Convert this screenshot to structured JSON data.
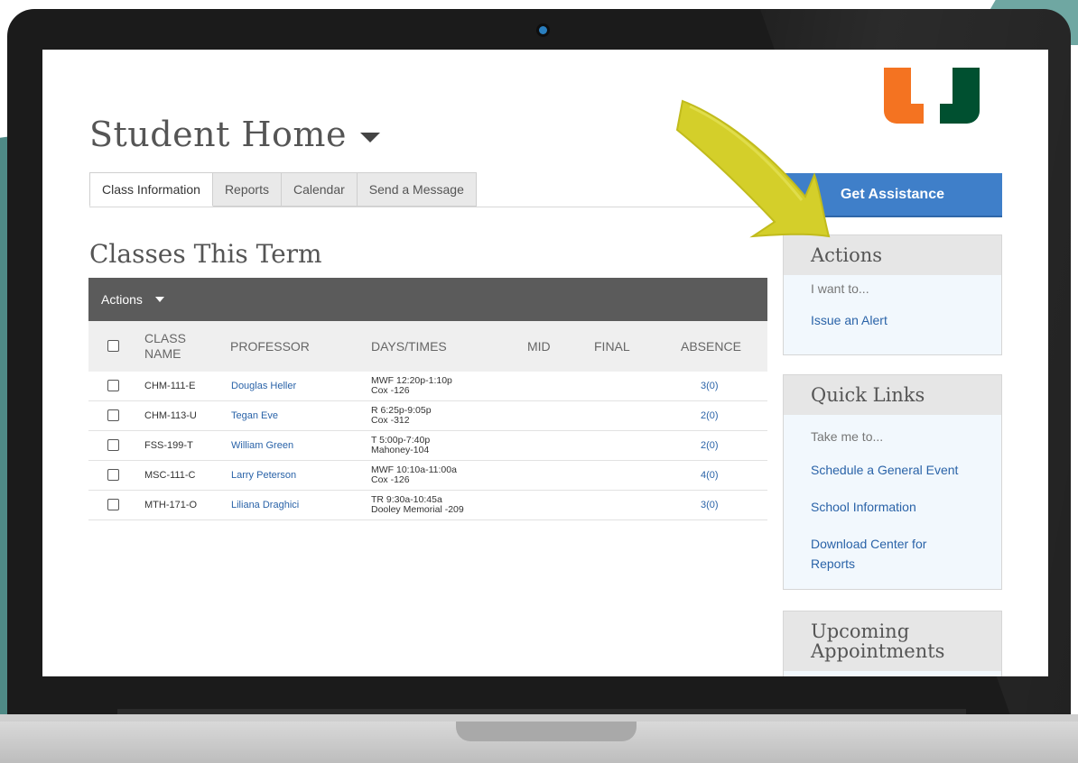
{
  "app": {
    "page_title": "Student Home",
    "tabs": [
      {
        "label": "Class Information",
        "active": true
      },
      {
        "label": "Reports",
        "active": false
      },
      {
        "label": "Calendar",
        "active": false
      },
      {
        "label": "Send a Message",
        "active": false
      }
    ]
  },
  "classes": {
    "section_title": "Classes This Term",
    "actions_label": "Actions",
    "columns": [
      "CLASS NAME",
      "PROFESSOR",
      "DAYS/TIMES",
      "MID",
      "FINAL",
      "ABSENCE"
    ],
    "rows": [
      {
        "class_name": "CHM-111-E",
        "professor": "Douglas Heller",
        "days": "MWF 12:20p-1:10p",
        "location": "Cox -126",
        "mid": "",
        "final": "",
        "absence": "3(0)"
      },
      {
        "class_name": "CHM-113-U",
        "professor": "Tegan Eve",
        "days": "R 6:25p-9:05p",
        "location": "Cox -312",
        "mid": "",
        "final": "",
        "absence": "2(0)"
      },
      {
        "class_name": "FSS-199-T",
        "professor": "William Green",
        "days": "T 5:00p-7:40p",
        "location": "Mahoney-104",
        "mid": "",
        "final": "",
        "absence": "2(0)"
      },
      {
        "class_name": "MSC-111-C",
        "professor": "Larry Peterson",
        "days": "MWF 10:10a-11:00a",
        "location": "Cox -126",
        "mid": "",
        "final": "",
        "absence": "4(0)"
      },
      {
        "class_name": "MTH-171-O",
        "professor": "Liliana Draghici",
        "days": "TR 9:30a-10:45a",
        "location": "Dooley Memorial -209",
        "mid": "",
        "final": "",
        "absence": "3(0)"
      }
    ]
  },
  "sidebar": {
    "assist_button": "Get Assistance",
    "actions_panel": {
      "title": "Actions",
      "subtitle": "I want to...",
      "links": [
        "Issue an Alert"
      ]
    },
    "quick_links_panel": {
      "title": "Quick Links",
      "subtitle": "Take me to...",
      "links": [
        "Schedule a General Event",
        "School Information",
        "Download Center for Reports"
      ]
    },
    "appointments_panel": {
      "title": "Upcoming Appointments"
    }
  },
  "colors": {
    "accent_blue": "#3f7fc9",
    "link_blue": "#2a63a8",
    "logo_orange": "#f47321",
    "logo_green": "#005030",
    "arrow_yellow": "#d4cf2a"
  },
  "icons": {
    "title_dropdown": "caret-down-icon",
    "actions_dropdown": "caret-down-icon",
    "row_select": "checkbox-icon",
    "logo": "u-logo-icon"
  }
}
